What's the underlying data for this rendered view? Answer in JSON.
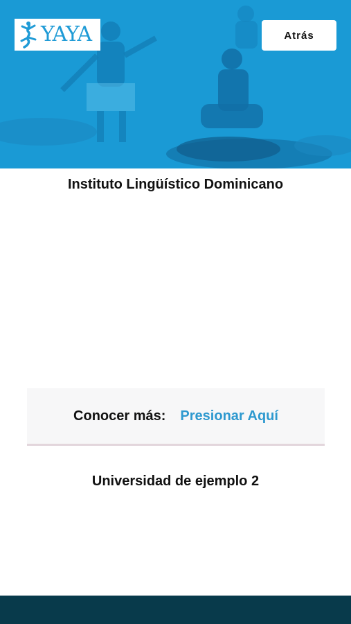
{
  "header": {
    "logo_text": "YAYA",
    "back_label": "Atrás"
  },
  "cards": [
    {
      "title": "Instituto Lingüístico Dominicano"
    },
    {
      "title": "Universidad de ejemplo 2"
    }
  ],
  "more": {
    "label": "Conocer más:",
    "link_label": "Presionar Aquí"
  },
  "colors": {
    "hero_blue": "#1ea3dc",
    "link_blue": "#2e99cf",
    "footer": "#083a4b"
  }
}
